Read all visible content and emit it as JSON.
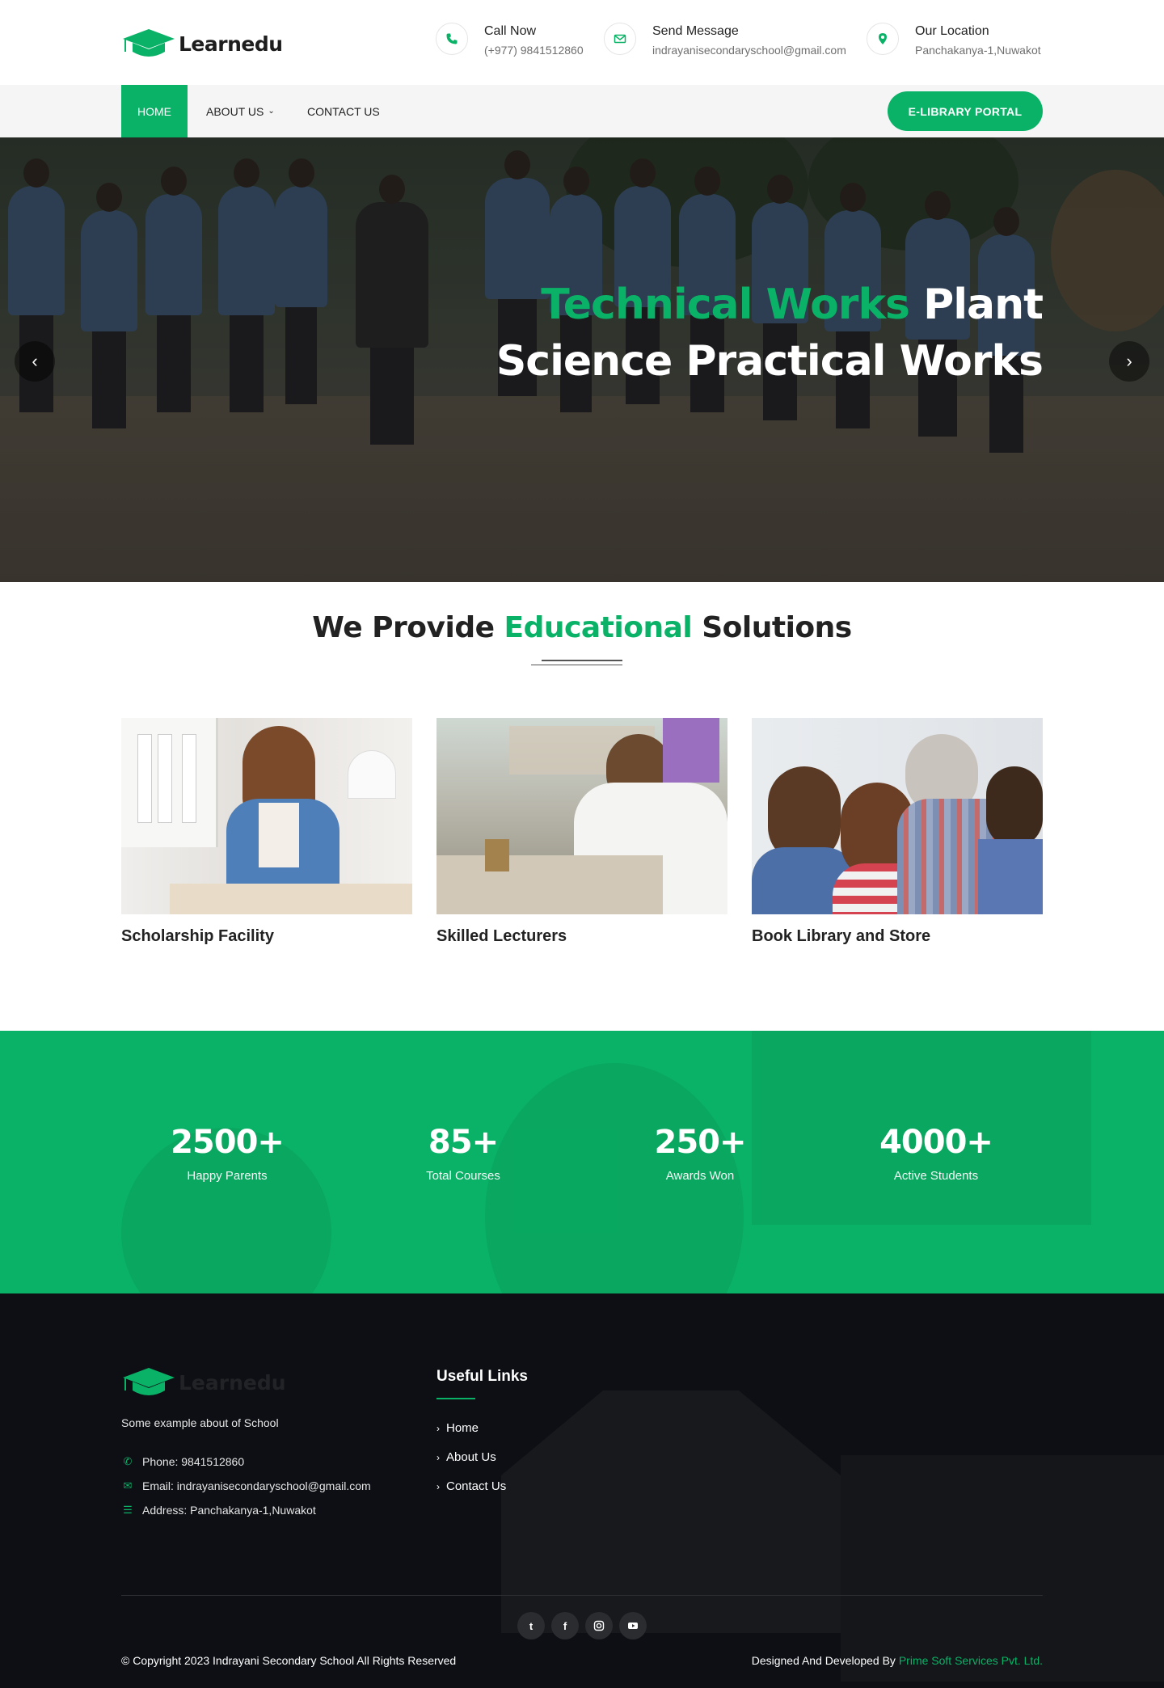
{
  "brand": {
    "name": "Learnedu",
    "accent": "#0ab267"
  },
  "topbar": {
    "contacts": [
      {
        "icon": "phone-icon",
        "title": "Call Now",
        "sub": "(+977) 9841512860"
      },
      {
        "icon": "envelope-icon",
        "title": "Send Message",
        "sub": "indrayanisecondaryschool@gmail.com"
      },
      {
        "icon": "map-pin-icon",
        "title": "Our Location",
        "sub": "Panchakanya-1,Nuwakot"
      }
    ]
  },
  "nav": {
    "items": [
      {
        "label": "HOME",
        "active": true
      },
      {
        "label": "ABOUT US",
        "has_dropdown": true
      },
      {
        "label": "CONTACT US"
      }
    ],
    "cta_label": "E-LIBRARY PORTAL"
  },
  "hero": {
    "title_green": "Technical Works",
    "title_white_1": " Plant",
    "title_white_2": "Science Practical Works",
    "prev_icon": "chevron-left-icon",
    "next_icon": "chevron-right-icon"
  },
  "solutions": {
    "title_pre": "We Provide ",
    "title_green": "Educational",
    "title_post": " Solutions",
    "cards": [
      {
        "caption": "Scholarship Facility"
      },
      {
        "caption": "Skilled Lecturers"
      },
      {
        "caption": "Book Library and Store"
      }
    ]
  },
  "stats": [
    {
      "value": "2500+",
      "label": "Happy Parents"
    },
    {
      "value": "85+",
      "label": "Total Courses"
    },
    {
      "value": "250+",
      "label": "Awards Won"
    },
    {
      "value": "4000+",
      "label": "Active Students"
    }
  ],
  "footer": {
    "about": "Some example about of School",
    "phone": "Phone: 9841512860",
    "email": "Email: indrayanisecondaryschool@gmail.com",
    "address": "Address: Panchakanya-1,Nuwakot",
    "useful_links_title": "Useful Links",
    "links": [
      "Home",
      "About Us",
      "Contact Us"
    ],
    "social": [
      "twitter-icon",
      "facebook-icon",
      "instagram-icon",
      "youtube-icon"
    ],
    "copyright": "© Copyright 2023 Indrayani Secondary School All Rights Reserved",
    "credit_pre": "Designed And Developed By ",
    "credit_link": "Prime Soft Services Pvt. Ltd."
  }
}
